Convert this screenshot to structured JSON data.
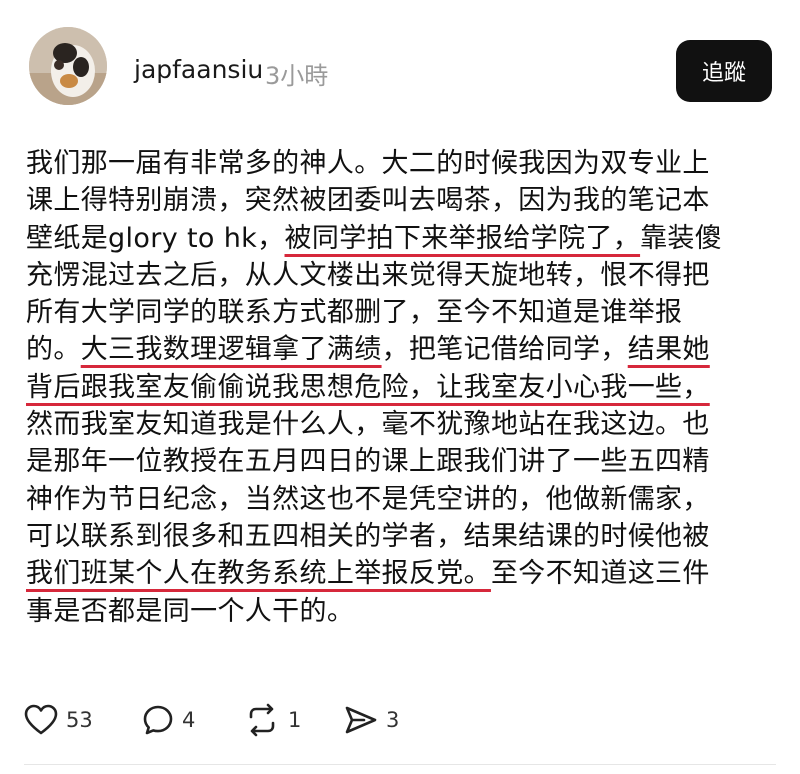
{
  "post": {
    "username": "japfaansiu",
    "time": "3小時",
    "follow_label": "追蹤",
    "avatar_icon": "cat-avatar-icon",
    "lines": [
      [
        {
          "text": "我们那一届有非常多的神人。大二的时候我因为双专业上",
          "hl": false
        }
      ],
      [
        {
          "text": "课上得特别崩溃，突然被团委叫去喝茶，因为我的笔记本",
          "hl": false
        }
      ],
      [
        {
          "text": "壁纸是glory to hk，",
          "hl": false
        },
        {
          "text": "被同学拍下来举报给学院了，",
          "hl": true
        },
        {
          "text": "靠装傻",
          "hl": false
        }
      ],
      [
        {
          "text": "充愣混过去之后，从人文楼出来觉得天旋地转，恨不得把",
          "hl": false
        }
      ],
      [
        {
          "text": "所有大学同学的联系方式都删了，至今不知道是谁举报",
          "hl": false
        }
      ],
      [
        {
          "text": "的。",
          "hl": false
        },
        {
          "text": "大三我数理逻辑拿了满绩",
          "hl": true
        },
        {
          "text": "，把笔记借给同学，",
          "hl": false
        },
        {
          "text": "结果她",
          "hl": true
        }
      ],
      [
        {
          "text": "背后跟我室友偷偷说我思想危险，让我室友小心我一些，",
          "hl": true
        }
      ],
      [
        {
          "text": "然而我室友知道我是什么人，毫不犹豫地站在我这边。也",
          "hl": false
        }
      ],
      [
        {
          "text": "是那年一位教授在五月四日的课上跟我们讲了一些五四精",
          "hl": false
        }
      ],
      [
        {
          "text": "神作为节日纪念，当然这也不是凭空讲的，他做新儒家，",
          "hl": false
        }
      ],
      [
        {
          "text": "可以联系到很多和五四相关的学者，结果结课的时候他被",
          "hl": false
        }
      ],
      [
        {
          "text": "我们班某个人在教务系统上举报反党。",
          "hl": true
        },
        {
          "text": "至今不知道这三件",
          "hl": false
        }
      ],
      [
        {
          "text": "事是否都是同一个人干的。",
          "hl": false
        }
      ]
    ],
    "highlight_color": "#d6283b"
  },
  "actions": {
    "like": {
      "icon": "heart-icon",
      "count": "53"
    },
    "comment": {
      "icon": "comment-bubble-icon",
      "count": "4"
    },
    "repost": {
      "icon": "repost-icon",
      "count": "1"
    },
    "share": {
      "icon": "send-icon",
      "count": "3"
    }
  }
}
